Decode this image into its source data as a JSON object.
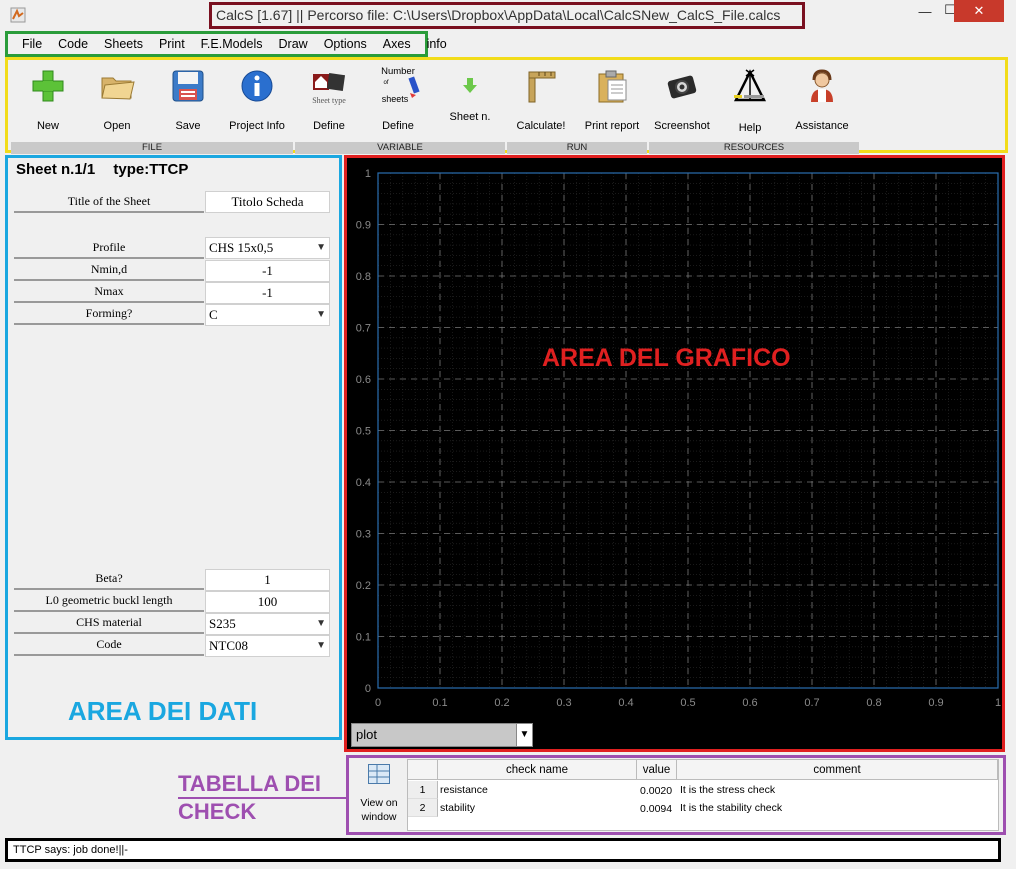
{
  "window": {
    "title": "CalcS [1.67] || Percorso file: C:\\Users\\Dropbox\\AppData\\Local\\CalcSNew_CalcS_File.calcs",
    "minimize": "—",
    "maximize": "☐",
    "close": "✕"
  },
  "menu": [
    "File",
    "Code",
    "Sheets",
    "Print",
    "F.E.Models",
    "Draw",
    "Options",
    "Axes",
    "info"
  ],
  "toolbar": {
    "new": "New",
    "open": "Open",
    "save": "Save",
    "project_info": "Project Info",
    "define_sheet": "Define",
    "define_sheet_icon_text": "Sheet type",
    "define_variable": "Define",
    "number_of_sheets_text_a": "Number",
    "number_of_sheets_text_b": "of",
    "number_of_sheets_text_c": "sheets",
    "sheet_n": "Sheet n.",
    "calculate": "Calculate!",
    "print_report": "Print report",
    "screenshot": "Screenshot",
    "help": "Help",
    "assistance": "Assistance",
    "groups": [
      "FILE",
      "VARIABLE",
      "RUN",
      "RESOURCES"
    ]
  },
  "sheet": {
    "number": "Sheet n.1/1",
    "type": "type:TTCP"
  },
  "fields": {
    "title_label": "Title of the Sheet",
    "title_value": "Titolo Scheda",
    "profile_label": "Profile",
    "profile_value": "CHS 15x0,5",
    "nmind_label": "Nmin,d",
    "nmind_value": "-1",
    "nmax_label": "Nmax",
    "nmax_value": "-1",
    "forming_label": "Forming?",
    "forming_value": "C",
    "beta_label": "Beta?",
    "beta_value": "1",
    "l0_label": "L0 geometric buckl length",
    "l0_value": "100",
    "chs_material_label": "CHS material",
    "chs_material_value": "S235",
    "code_label": "Code",
    "code_value": "NTC08"
  },
  "labels": {
    "data_area": "AREA DEI DATI",
    "graph_area": "AREA DEL GRAFICO",
    "check_table_line1": "TABELLA DEI",
    "check_table_line2": "CHECK"
  },
  "plot": {
    "select_value": "plot",
    "x_ticks": [
      "0",
      "0.1",
      "0.2",
      "0.3",
      "0.4",
      "0.5",
      "0.6",
      "0.7",
      "0.8",
      "0.9",
      "1"
    ],
    "y_ticks": [
      "0",
      "0.1",
      "0.2",
      "0.3",
      "0.4",
      "0.5",
      "0.6",
      "0.7",
      "0.8",
      "0.9",
      "1"
    ]
  },
  "checks": {
    "view_button_line1": "View on",
    "view_button_line2": "window",
    "headers": [
      "check name",
      "value",
      "comment"
    ],
    "rows": [
      {
        "n": "1",
        "name": "resistance",
        "value": "0.0020",
        "comment": "It is the stress check"
      },
      {
        "n": "2",
        "name": "stability",
        "value": "0.0094",
        "comment": "It is the stability check"
      }
    ]
  },
  "status": "TTCP says: job done!||-"
}
